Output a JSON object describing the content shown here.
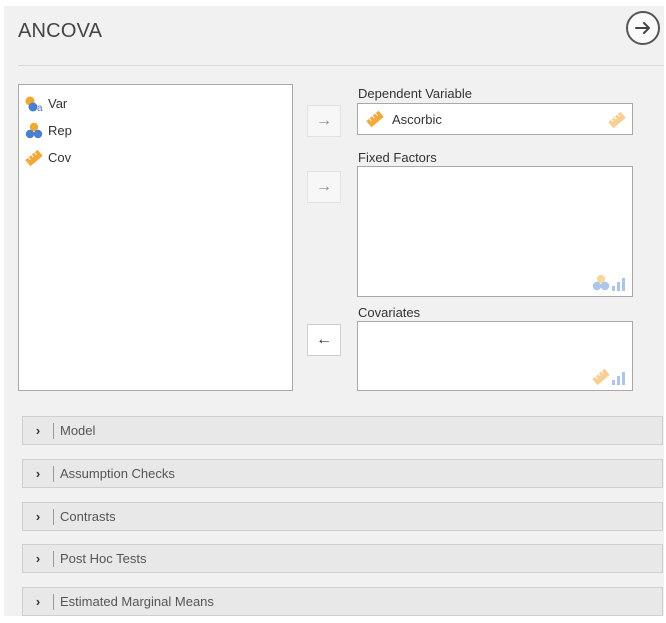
{
  "analysis": {
    "title": "ANCOVA"
  },
  "variables": [
    {
      "name": "Var",
      "icon": "nominal-text-icon"
    },
    {
      "name": "Rep",
      "icon": "nominal-icon"
    },
    {
      "name": "Cov",
      "icon": "continuous-ruler-icon"
    }
  ],
  "dependent": {
    "label": "Dependent Variable",
    "value": "Ascorbic"
  },
  "fixed_factors": {
    "label": "Fixed Factors"
  },
  "covariates": {
    "label": "Covariates"
  },
  "transfer_buttons": {
    "to_dependent": "→",
    "to_factors": "→",
    "from_covariates": "←"
  },
  "sections": [
    {
      "label": "Model",
      "chevron": "›"
    },
    {
      "label": "Assumption Checks",
      "chevron": "›"
    },
    {
      "label": "Contrasts",
      "chevron": "›"
    },
    {
      "label": "Post Hoc Tests",
      "chevron": "›"
    },
    {
      "label": "Estimated Marginal Means",
      "chevron": "›"
    }
  ],
  "colors": {
    "panel": "#f1f1f1",
    "nominal_blue": "#4a7fd0",
    "nominal_orange": "#f0a830",
    "ruler_orange": "#f2a93b"
  }
}
